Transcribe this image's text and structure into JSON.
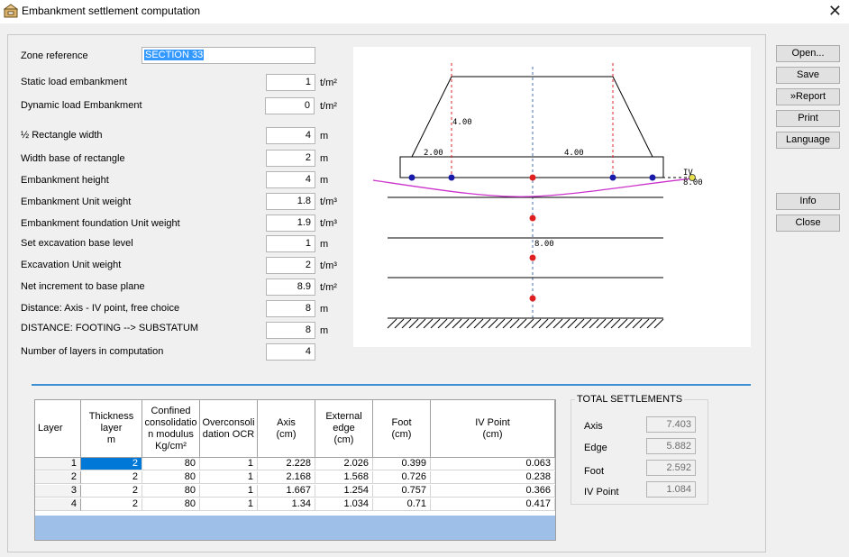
{
  "window": {
    "title": "Embankment settlement computation"
  },
  "form": {
    "zone_label": "Zone reference",
    "zone_value": "SECTION 33",
    "static_label": "Static load embankment",
    "static_value": "1",
    "static_unit": "t/m²",
    "dynamic_label": "Dynamic load Embankment",
    "dynamic_value": "0",
    "dynamic_unit": "t/m²",
    "halfrect_label": "½ Rectangle width",
    "halfrect_value": "4",
    "halfrect_unit": "m",
    "widthbase_label": "Width base of rectangle",
    "widthbase_value": "2",
    "widthbase_unit": "m",
    "height_label": "Embankment height",
    "height_value": "4",
    "height_unit": "m",
    "unitw_label": "Embankment Unit weight",
    "unitw_value": "1.8",
    "unitw_unit": "t/m³",
    "foundw_label": "Embankment foundation Unit weight",
    "foundw_value": "1.9",
    "foundw_unit": "t/m³",
    "excavlevel_label": "Set excavation base level",
    "excavlevel_value": "1",
    "excavlevel_unit": "m",
    "excavw_label": "Excavation Unit weight",
    "excavw_value": "2",
    "excavw_unit": "t/m³",
    "netinc_label": "Net increment to base plane",
    "netinc_value": "8.9",
    "netinc_unit": "t/m²",
    "dist_label": "Distance: Axis - IV point, free choice",
    "dist_value": "8",
    "dist_unit": "m",
    "footing_label": "DISTANCE: FOOTING --> SUBSTATUM",
    "footing_value": "8",
    "footing_unit": "m",
    "layers_label": "Number of layers in computation",
    "layers_value": "4"
  },
  "buttons": {
    "open": "Open...",
    "save": "Save",
    "report": "Report",
    "print": "Print",
    "language": "Language",
    "info": "Info",
    "close": "Close"
  },
  "diagram": {
    "dim_height": "4.00",
    "dim_base": "2.00",
    "dim_half": "4.00",
    "dim_iv": "8.00",
    "dim_depth": "8.00",
    "iv_label": "IV"
  },
  "table": {
    "headers": [
      "Layer",
      "Thickness layer m",
      "Confined consolidation modulus Kg/cm²",
      "Overconsolidation OCR",
      "Axis (cm)",
      "External edge (cm)",
      "Foot (cm)",
      "IV Point (cm)"
    ],
    "header_lines": [
      [
        "Layer"
      ],
      [
        "Thickness",
        "layer",
        "m"
      ],
      [
        "Confined",
        "consolidatio",
        "n modulus",
        "Kg/cm²"
      ],
      [
        "Overconsoli",
        "dation OCR"
      ],
      [
        "Axis",
        "(cm)"
      ],
      [
        "External",
        "edge",
        "(cm)"
      ],
      [
        "Foot",
        "(cm)"
      ],
      [
        "IV Point",
        "(cm)"
      ]
    ],
    "rows": [
      [
        "1",
        "2",
        "80",
        "1",
        "2.228",
        "2.026",
        "0.399",
        "0.063"
      ],
      [
        "2",
        "2",
        "80",
        "1",
        "2.168",
        "1.568",
        "0.726",
        "0.238"
      ],
      [
        "3",
        "2",
        "80",
        "1",
        "1.667",
        "1.254",
        "0.757",
        "0.366"
      ],
      [
        "4",
        "2",
        "80",
        "1",
        "1.34",
        "1.034",
        "0.71",
        "0.417"
      ]
    ]
  },
  "totals": {
    "title": "TOTAL SETTLEMENTS",
    "axis_label": "Axis",
    "axis_value": "7.403",
    "edge_label": "Edge",
    "edge_value": "5.882",
    "foot_label": "Foot",
    "foot_value": "2.592",
    "iv_label": "IV Point",
    "iv_value": "1.084"
  },
  "colors": {
    "selection": "#0078d7",
    "separator": "#3c8fd4",
    "footer": "#9ebfe8",
    "settlement_curve": "#cc33cc",
    "point_red": "#e02020",
    "point_blue": "#1a1aa8"
  },
  "icons": [
    "app-icon",
    "close-icon"
  ]
}
